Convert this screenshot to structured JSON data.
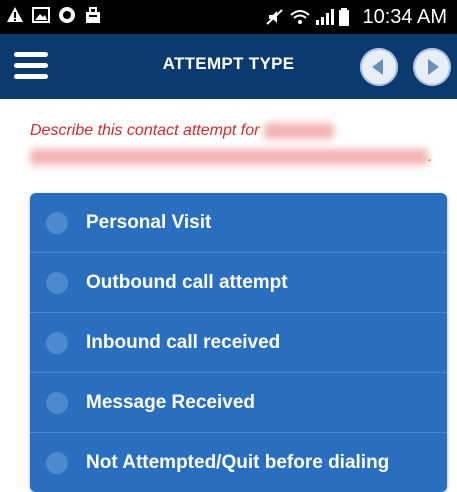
{
  "statusbar": {
    "time": "10:34 AM",
    "left_icons": [
      "warning-icon",
      "image-icon",
      "app-icon",
      "bag-icon"
    ],
    "right_icons": [
      "mute-icon",
      "wifi-icon",
      "signal-icon",
      "battery-icon"
    ]
  },
  "header": {
    "title": "ATTEMPT TYPE"
  },
  "prompt": {
    "text": "Describe this contact attempt for",
    "trailing": "."
  },
  "options": [
    {
      "label": "Personal Visit",
      "selected": false
    },
    {
      "label": "Outbound call attempt",
      "selected": false
    },
    {
      "label": "Inbound call received",
      "selected": false
    },
    {
      "label": "Message Received",
      "selected": false
    },
    {
      "label": "Not Attempted/Quit before dialing",
      "selected": false
    }
  ],
  "colors": {
    "appbar": "#0b3a6e",
    "options_bg": "#2a6fbf",
    "prompt_text": "#d12a2a"
  }
}
